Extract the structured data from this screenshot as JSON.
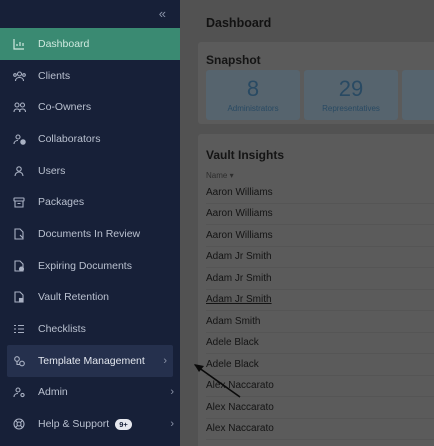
{
  "sidebar": {
    "collapse_icon": "«",
    "items": [
      {
        "label": "Dashboard",
        "icon": "chart-icon",
        "state": "active"
      },
      {
        "label": "Clients",
        "icon": "users-group-icon"
      },
      {
        "label": "Co-Owners",
        "icon": "co-owners-icon"
      },
      {
        "label": "Collaborators",
        "icon": "collaborators-icon"
      },
      {
        "label": "Users",
        "icon": "user-icon"
      },
      {
        "label": "Packages",
        "icon": "package-icon"
      },
      {
        "label": "Documents In Review",
        "icon": "document-review-icon"
      },
      {
        "label": "Expiring Documents",
        "icon": "document-expiring-icon"
      },
      {
        "label": "Vault Retention",
        "icon": "vault-icon"
      },
      {
        "label": "Checklists",
        "icon": "checklist-icon"
      },
      {
        "label": "Template Management",
        "icon": "template-icon",
        "state": "hover",
        "has_submenu": true
      },
      {
        "label": "Admin",
        "icon": "admin-icon",
        "has_submenu": true
      },
      {
        "label": "Help & Support",
        "icon": "help-icon",
        "has_submenu": true,
        "badge": "9+"
      }
    ]
  },
  "main": {
    "title": "Dashboard",
    "snapshot": {
      "title": "Snapshot",
      "stats": [
        {
          "value": "8",
          "label": "Administrators"
        },
        {
          "value": "29",
          "label": "Representatives"
        }
      ]
    },
    "vault_insights": {
      "title": "Vault Insights",
      "column_header": "Name ▾",
      "rows": [
        "Aaron Williams",
        "Aaron Williams",
        "Aaron Williams",
        "Adam Jr Smith",
        "Adam Jr Smith",
        "Adam Jr Smith",
        "Adam Smith",
        "Adele Black",
        "Adele Black",
        "Alex Naccarato",
        "Alex Naccarato",
        "Alex Naccarato"
      ]
    }
  },
  "colors": {
    "sidebar_bg": "#172038",
    "active_item": "#3a8a72",
    "overlay_bg": "#525252",
    "stat_text": "#294a63"
  }
}
